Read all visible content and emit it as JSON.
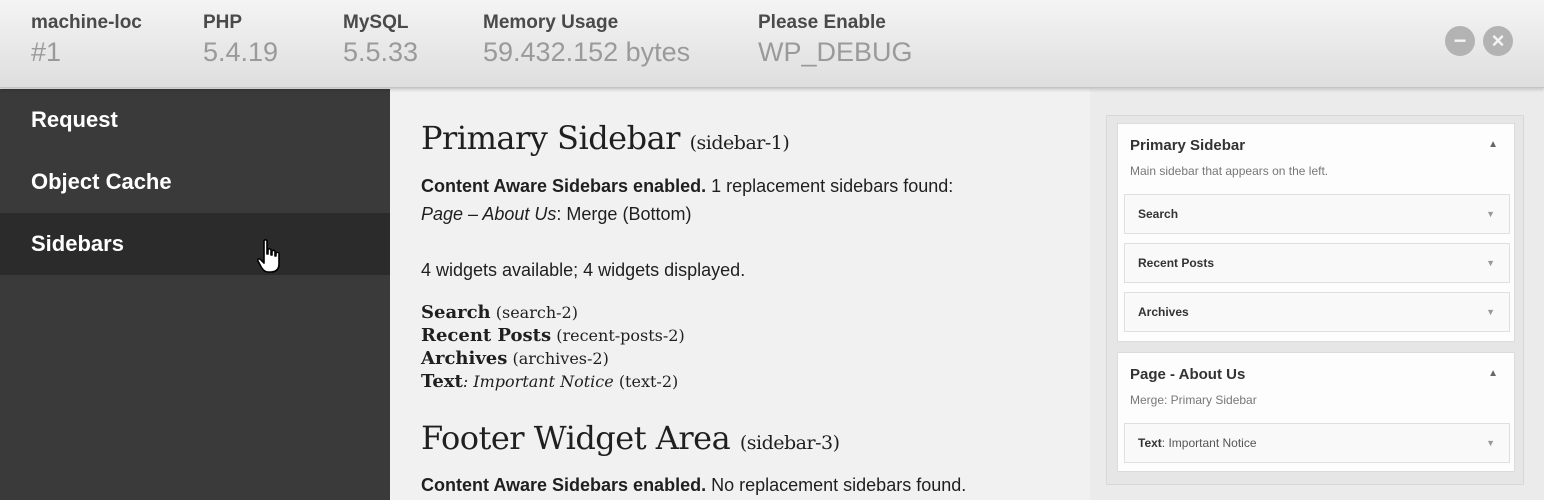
{
  "topbar": {
    "stats": [
      {
        "label": "machine-loc",
        "value": "#1"
      },
      {
        "label": "PHP",
        "value": "5.4.19"
      },
      {
        "label": "MySQL",
        "value": "5.5.33"
      },
      {
        "label": "Memory Usage",
        "value": "59.432.152 bytes"
      },
      {
        "label": "Please Enable",
        "value": "WP_DEBUG"
      }
    ],
    "minimize_icon": "minus-circle-icon",
    "close_icon": "close-circle-icon"
  },
  "nav": {
    "items": [
      {
        "label": "Request"
      },
      {
        "label": "Object Cache"
      },
      {
        "label": "Sidebars",
        "active": true
      }
    ]
  },
  "main": {
    "primary": {
      "title": "Primary Sidebar",
      "id": "(sidebar-1)",
      "cas_bold": "Content Aware Sidebars enabled.",
      "cas_rest": "1 replacement sidebars found:",
      "replacement_page": "Page – About Us",
      "replacement_rest": ": Merge (Bottom)",
      "widgets_summary": "4 widgets available; 4 widgets displayed.",
      "widgets": [
        {
          "name": "Search",
          "title": "",
          "id": "(search-2)"
        },
        {
          "name": "Recent Posts",
          "title": "",
          "id": "(recent-posts-2)"
        },
        {
          "name": "Archives",
          "title": "",
          "id": "(archives-2)"
        },
        {
          "name": "Text",
          "title": ": Important Notice",
          "id": "(text-2)"
        }
      ]
    },
    "footer": {
      "title": "Footer Widget Area",
      "id": "(sidebar-3)",
      "cas_bold": "Content Aware Sidebars enabled.",
      "cas_rest": "No replacement sidebars found."
    }
  },
  "panel": {
    "cards": [
      {
        "title": "Primary Sidebar",
        "description": "Main sidebar that appears on the left.",
        "widgets": [
          {
            "name": "Search",
            "sub": ""
          },
          {
            "name": "Recent Posts",
            "sub": ""
          },
          {
            "name": "Archives",
            "sub": ""
          }
        ]
      },
      {
        "title": "Page - About Us",
        "description": "Merge: Primary Sidebar",
        "widgets": [
          {
            "name": "Text",
            "sub": ": Important Notice"
          }
        ]
      }
    ]
  }
}
